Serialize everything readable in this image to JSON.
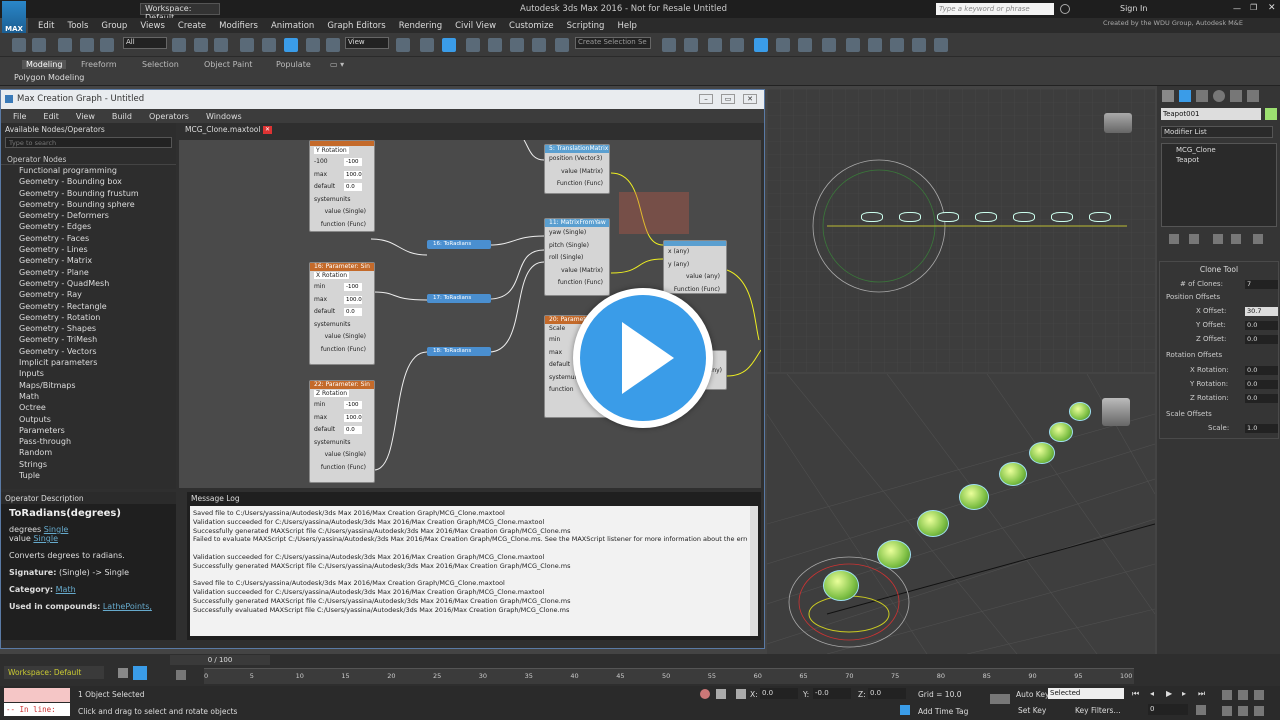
{
  "app": {
    "logo_text": "MAX",
    "workspace": "Workspace: Default",
    "window_title": "Autodesk 3ds Max 2016 - Not for Resale   Untitled",
    "search_placeholder": "Type a keyword or phrase",
    "sign_in": "Sign In",
    "credit": "Created by the WDU Group, Autodesk M&E"
  },
  "menu": [
    "Edit",
    "Tools",
    "Group",
    "Views",
    "Create",
    "Modifiers",
    "Animation",
    "Graph Editors",
    "Rendering",
    "Civil View",
    "Customize",
    "Scripting",
    "Help"
  ],
  "toolbar": {
    "filter": "All",
    "view": "View",
    "selection_set": "Create Selection Se"
  },
  "ribbon": {
    "tabs": [
      "Modeling",
      "Freeform",
      "Selection",
      "Object Paint",
      "Populate"
    ],
    "sub": "Polygon Modeling"
  },
  "mcg": {
    "title": "Max Creation Graph - Untitled",
    "menu": [
      "File",
      "Edit",
      "View",
      "Build",
      "Operators",
      "Windows"
    ],
    "available_label": "Available Nodes/Operators",
    "search_placeholder": "Type to search",
    "tab": "MCG_Clone.maxtool",
    "operator_nodes_label": "Operator Nodes",
    "operator_nodes": [
      "Functional programming",
      "Geometry - Bounding box",
      "Geometry - Bounding frustum",
      "Geometry - Bounding sphere",
      "Geometry - Deformers",
      "Geometry - Edges",
      "Geometry - Faces",
      "Geometry - Lines",
      "Geometry - Matrix",
      "Geometry - Plane",
      "Geometry - QuadMesh",
      "Geometry - Ray",
      "Geometry - Rectangle",
      "Geometry - Rotation",
      "Geometry - Shapes",
      "Geometry - TriMesh",
      "Geometry - Vectors",
      "Implicit parameters",
      "Inputs",
      "Maps/Bitmaps",
      "Math",
      "Octree",
      "Outputs",
      "Parameters",
      "Pass-through",
      "Random",
      "Strings",
      "Tuple"
    ],
    "nodes": {
      "y_rot": {
        "head": "",
        "label": "Y Rotation",
        "min": "-100",
        "max": "100.0",
        "default": "0.0",
        "sysunits": "systemunits",
        "value": "value (Single)",
        "function": "function (Func)"
      },
      "x_rot": {
        "head": "16: Parameter: Sin",
        "label": "X Rotation",
        "min": "-100",
        "max": "100.0",
        "default": "0.0",
        "sysunits": "systemunits",
        "value": "value (Single)",
        "function": "function (Func)"
      },
      "z_rot": {
        "head": "22: Parameter: Sin",
        "label": "Z Rotation",
        "min": "-100",
        "max": "100.0",
        "default": "0.0",
        "sysunits": "systemunits",
        "value": "value (Single)",
        "function": "function (Func)"
      },
      "translation": {
        "head": "5: TranslationMatrix",
        "position": "position (Vector3)",
        "value": "value (Matrix)",
        "function": "Function (Func)"
      },
      "matrix_from": {
        "head": "11: MatrixFromYaw",
        "yaw": "yaw (Single)",
        "pitch": "pitch (Single)",
        "roll": "roll (Single)",
        "value": "value (Matrix)",
        "function": "function (Func)"
      },
      "combine": {
        "x": "x (any)",
        "y": "y (any)",
        "value": "value (any)",
        "function": "Function (Func)"
      },
      "param_scale": {
        "head": "20: Parameter: Sin",
        "label": "Scale",
        "min": "min",
        "max": "max",
        "default": "default",
        "sysunits": "systemunits",
        "function": "function",
        "value": "(any)"
      },
      "to_rad_1": "16: ToRadians",
      "to_rad_2": "17: ToRadians",
      "to_rad_3": "18: ToRadians"
    },
    "op_desc": {
      "header": "Operator Description",
      "title": "ToRadians(degrees)",
      "l1": "degrees",
      "l1v": "Single",
      "l2": "value",
      "l2v": "Single",
      "desc": "Converts degrees to radians.",
      "sig_label": "Signature:",
      "sig": "(Single) -> Single",
      "cat_label": "Category:",
      "cat": "Math",
      "used_label": "Used in compounds:",
      "used": "LathePoints,"
    },
    "log": {
      "header": "Message Log",
      "lines": [
        "Saved file to C:/Users/yassina/Autodesk/3ds Max 2016/Max Creation Graph/MCG_Clone.maxtool",
        "Validation succeeded for C:/Users/yassina/Autodesk/3ds Max 2016/Max Creation Graph/MCG_Clone.maxtool",
        "Successfully generated MAXScript file C:/Users/yassina/Autodesk/3ds Max 2016/Max Creation Graph/MCG_Clone.ms",
        "Failed to evaluate MAXScript C:/Users/yassina/Autodesk/3ds Max 2016/Max Creation Graph/MCG_Clone.ms. See the MAXScript listener for more information about the error.",
        "",
        "Validation succeeded for C:/Users/yassina/Autodesk/3ds Max 2016/Max Creation Graph/MCG_Clone.maxtool",
        "Successfully generated MAXScript file C:/Users/yassina/Autodesk/3ds Max 2016/Max Creation Graph/MCG_Clone.ms",
        "",
        "Saved file to C:/Users/yassina/Autodesk/3ds Max 2016/Max Creation Graph/MCG_Clone.maxtool",
        "Validation succeeded for C:/Users/yassina/Autodesk/3ds Max 2016/Max Creation Graph/MCG_Clone.maxtool",
        "Successfully generated MAXScript file C:/Users/yassina/Autodesk/3ds Max 2016/Max Creation Graph/MCG_Clone.ms",
        "Successfully evaluated MAXScript file C:/Users/yassina/Autodesk/3ds Max 2016/Max Creation Graph/MCG_Clone.ms"
      ]
    }
  },
  "cmd": {
    "object_name": "Teapot001",
    "modifier_list": "Modifier List",
    "stack": [
      "MCG_Clone",
      "Teapot"
    ],
    "rollout": "Clone Tool",
    "clones_label": "# of Clones:",
    "clones": "7",
    "pos_offsets": "Position Offsets",
    "x_off_label": "X Offset:",
    "x_off": "30.7",
    "y_off_label": "Y Offset:",
    "y_off": "0.0",
    "z_off_label": "Z Offset:",
    "z_off": "0.0",
    "rot_offsets": "Rotation Offsets",
    "x_rot_label": "X Rotation:",
    "x_rot": "0.0",
    "y_rot_label": "Y Rotation:",
    "y_rot": "0.0",
    "z_rot_label": "Z Rotation:",
    "z_rot": "0.0",
    "scale_offsets": "Scale Offsets",
    "scale_label": "Scale:",
    "scale": "1.0"
  },
  "timeline": {
    "frame": "0 / 100",
    "ticks": [
      "0",
      "5",
      "10",
      "15",
      "20",
      "25",
      "30",
      "35",
      "40",
      "45",
      "50",
      "55",
      "60",
      "65",
      "70",
      "75",
      "80",
      "85",
      "90",
      "95",
      "100"
    ]
  },
  "status": {
    "workspace": "Workspace: Default",
    "maxscript": "-- In line:",
    "selected": "1 Object Selected",
    "hint": "Click and drag to select and rotate objects",
    "x_label": "X:",
    "x": "0.0",
    "y_label": "Y:",
    "y": "-0.0",
    "z_label": "Z:",
    "z": "0.0",
    "grid": "Grid = 10.0",
    "add_time_tag": "Add Time Tag",
    "auto_key": "Auto Key",
    "set_key": "Set Key",
    "key_mode": "Selected",
    "key_filters": "Key Filters...",
    "frame": "0"
  },
  "colors": {
    "accent": "#3a9ce8",
    "teapot": "#7ec045",
    "node_head": "#c46a2a"
  }
}
